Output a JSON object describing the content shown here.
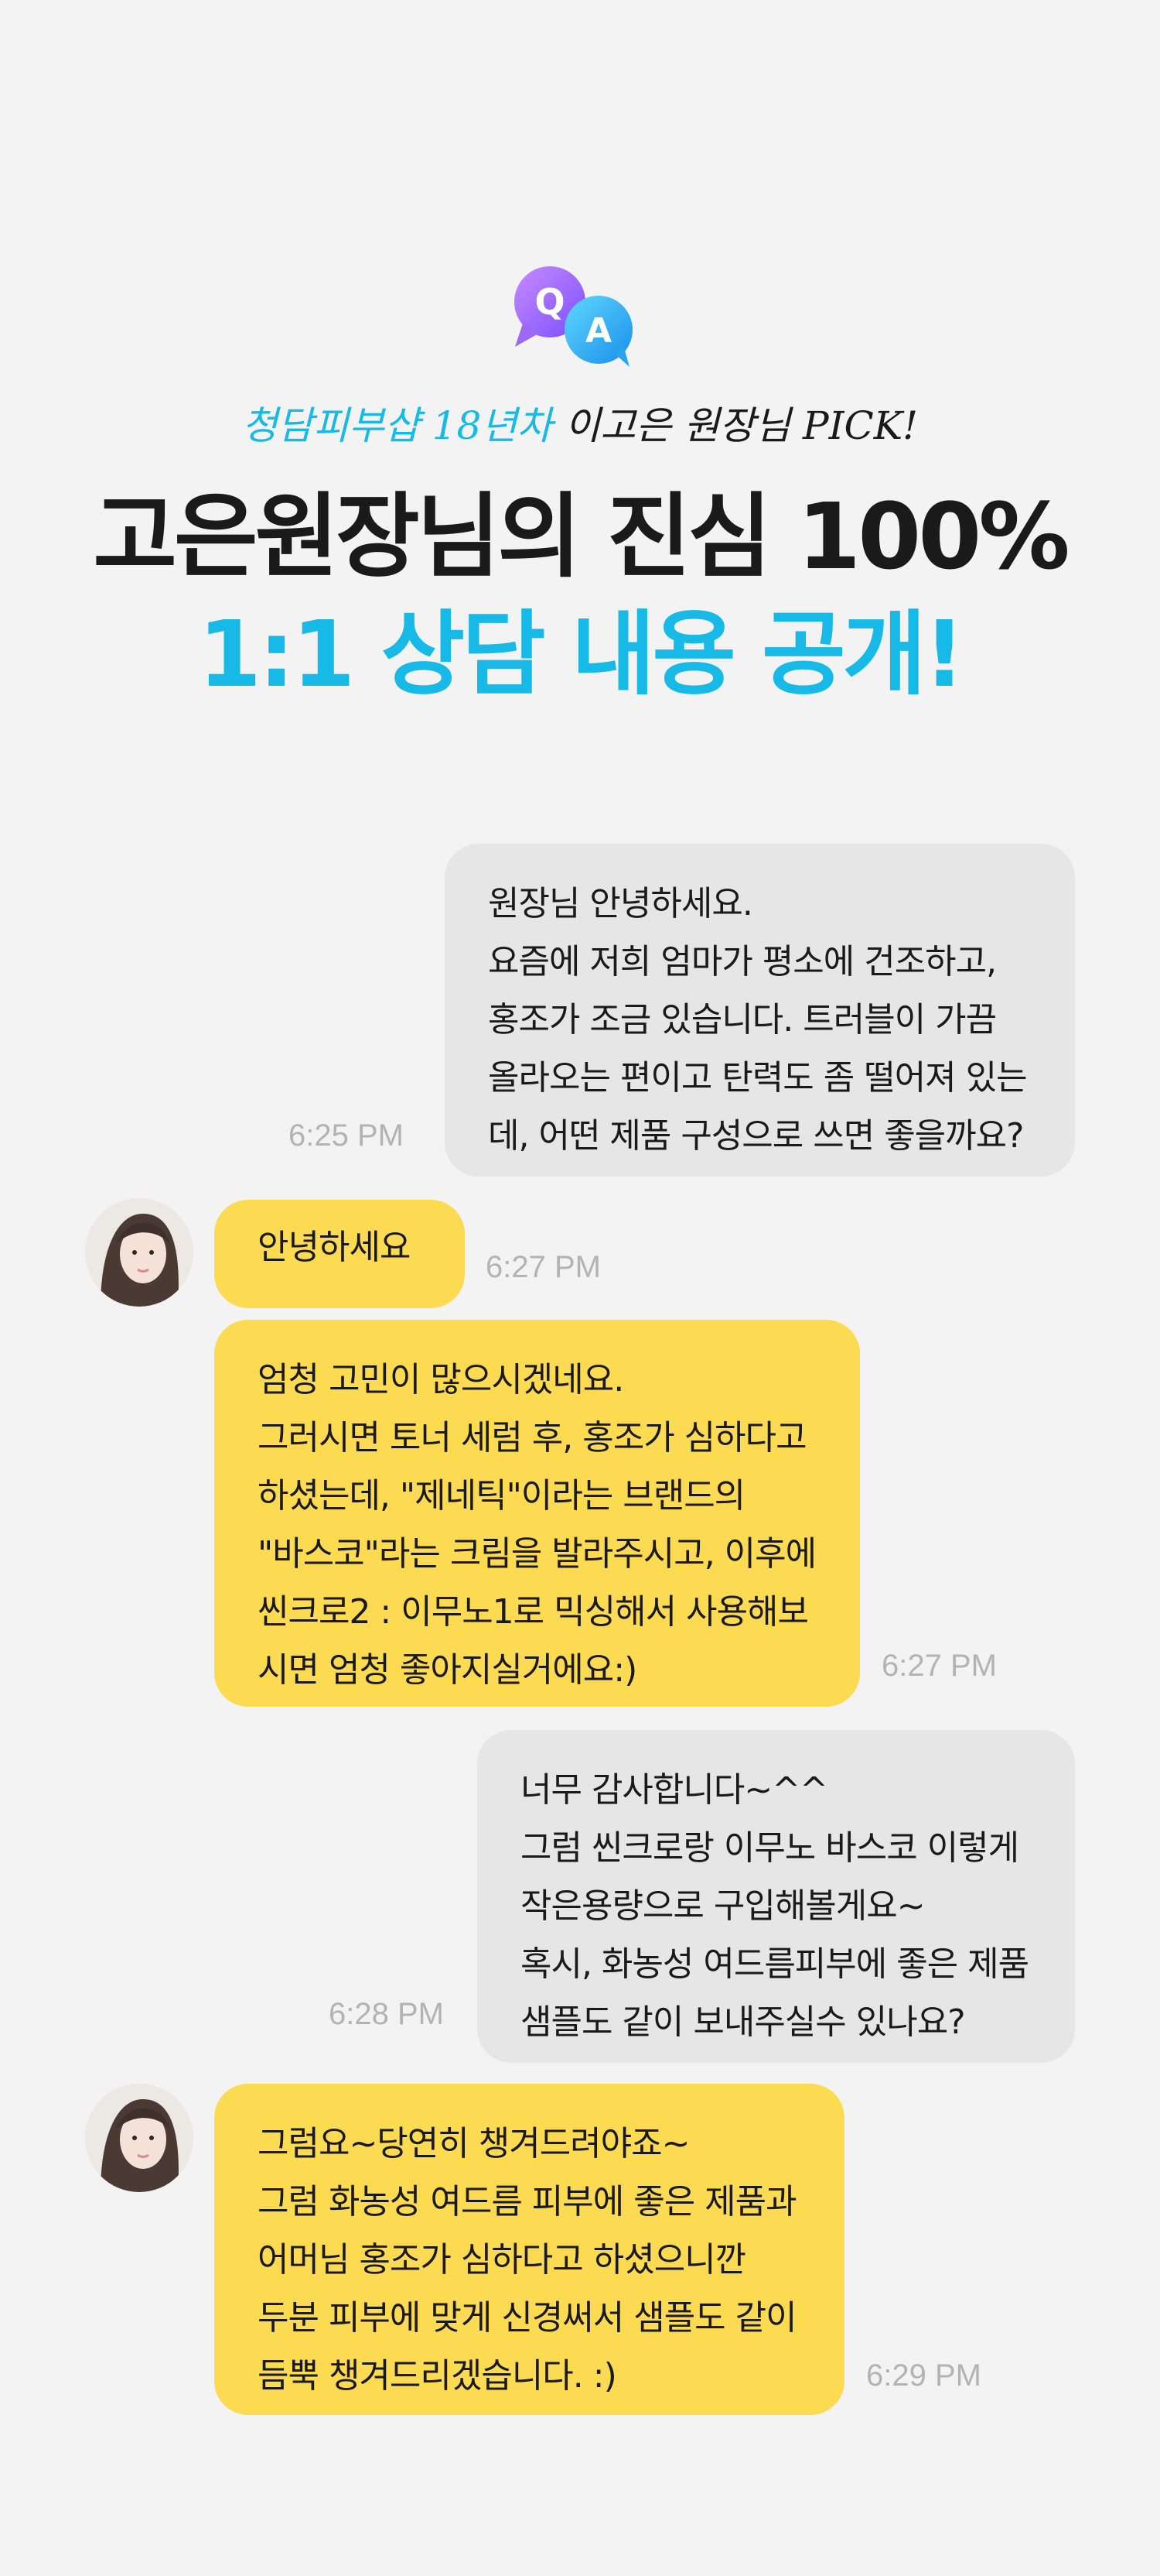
{
  "badge": {
    "q": "Q",
    "a": "A"
  },
  "header": {
    "subtitle_accent": "청담피부샵 18년차",
    "subtitle_rest": " 이고은 원장님 PICK!",
    "title_line1": "고은원장님의 진심 100%",
    "title_line2": "1:1 상담 내용 공개!"
  },
  "colors": {
    "accent": "#17b9e6",
    "my_bubble": "#e6e6e6",
    "reply_bubble": "#fcdb52",
    "time": "#b3b3b3"
  },
  "messages": [
    {
      "from": "customer",
      "text": "원장님 안녕하세요.\n요즘에 저희 엄마가 평소에 건조하고,\n홍조가 조금 있습니다. 트러블이 가끔\n올라오는 편이고 탄력도 좀 떨어져 있는\n데, 어떤 제품 구성으로 쓰면 좋을까요?",
      "time": "6:25 PM"
    },
    {
      "from": "director",
      "text": "안녕하세요",
      "time": "6:27 PM"
    },
    {
      "from": "director",
      "text": "엄청 고민이 많으시겠네요.\n그러시면 토너 세럼 후, 홍조가 심하다고\n하셨는데, \"제네틱\"이라는 브랜드의\n\"바스코\"라는 크림을 발라주시고, 이후에\n씬크로2 : 이무노1로 믹싱해서 사용해보\n시면 엄청 좋아지실거에요:)",
      "time": "6:27 PM"
    },
    {
      "from": "customer",
      "text": "너무 감사합니다~^^\n그럼 씬크로랑 이무노 바스코 이렇게\n작은용량으로 구입해볼게요~\n혹시, 화농성 여드름피부에 좋은 제품\n샘플도 같이 보내주실수 있나요?",
      "time": "6:28 PM"
    },
    {
      "from": "director",
      "text": "그럼요~당연히 챙겨드려야죠~\n그럼 화농성 여드름 피부에 좋은 제품과\n어머님 홍조가 심하다고 하셨으니깐\n두분 피부에 맞게 신경써서 샘플도 같이\n듬뿍 챙겨드리겠습니다. :)",
      "time": "6:29 PM"
    }
  ]
}
